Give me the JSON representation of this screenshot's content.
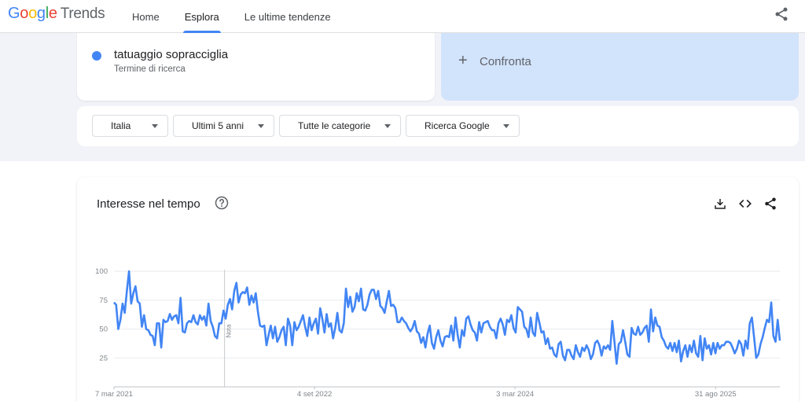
{
  "header": {
    "logo_letters": [
      {
        "ch": "G",
        "color": "#4285f4"
      },
      {
        "ch": "o",
        "color": "#ea4335"
      },
      {
        "ch": "o",
        "color": "#fbbc05"
      },
      {
        "ch": "g",
        "color": "#4285f4"
      },
      {
        "ch": "l",
        "color": "#34a853"
      },
      {
        "ch": "e",
        "color": "#ea4335"
      }
    ],
    "logo_product": "Trends",
    "nav": [
      "Home",
      "Esplora",
      "Le ultime tendenze"
    ],
    "active_nav": "Esplora",
    "share_icon": "share-icon"
  },
  "term": {
    "name": "tatuaggio sopracciglia",
    "subtitle": "Termine di ricerca",
    "color": "#4285f4"
  },
  "compare": {
    "plus": "+",
    "label": "Confronta"
  },
  "filters": [
    "Italia",
    "Ultimi 5 anni",
    "Tutte le categorie",
    "Ricerca Google"
  ],
  "chart_panel": {
    "title": "Interesse nel tempo",
    "help_icon": "help-circle-icon",
    "actions": [
      "download-icon",
      "embed-code-icon",
      "share-icon"
    ]
  },
  "chart_data": {
    "type": "line",
    "title": "Interesse nel tempo",
    "xlabel": "",
    "ylabel": "",
    "yticks": [
      25,
      50,
      75,
      100
    ],
    "ylim": [
      0,
      100
    ],
    "xlim": [
      "2021-03-07",
      "2026-02-22"
    ],
    "xtick_labels": [
      {
        "date": "2021-03-07",
        "label": "7 mar 2021"
      },
      {
        "date": "2022-09-04",
        "label": "4 set 2022"
      },
      {
        "date": "2024-03-03",
        "label": "3 mar 2024"
      },
      {
        "date": "2025-08-31",
        "label": "31 ago 2025"
      }
    ],
    "annotation_date": "2022-01-02",
    "annotation_label": "Nota",
    "grid": true,
    "line_color": "#4285f4",
    "series": [
      {
        "name": "tatuaggio sopracciglia",
        "values": [
          73,
          71,
          50,
          58,
          72,
          64,
          83,
          100,
          72,
          81,
          87,
          74,
          72,
          52,
          62,
          50,
          49,
          45,
          44,
          36,
          55,
          55,
          34,
          58,
          56,
          57,
          63,
          58,
          61,
          62,
          55,
          77,
          48,
          47,
          55,
          57,
          56,
          62,
          56,
          54,
          62,
          58,
          61,
          53,
          72,
          57,
          52,
          44,
          42,
          55,
          55,
          66,
          59,
          71,
          76,
          67,
          83,
          90,
          73,
          80,
          82,
          81,
          86,
          71,
          79,
          73,
          81,
          65,
          53,
          52,
          53,
          36,
          45,
          53,
          42,
          52,
          39,
          43,
          49,
          52,
          36,
          59,
          53,
          36,
          56,
          49,
          52,
          57,
          62,
          52,
          44,
          60,
          49,
          55,
          59,
          46,
          68,
          59,
          47,
          63,
          52,
          55,
          42,
          51,
          64,
          49,
          47,
          55,
          85,
          69,
          78,
          65,
          69,
          81,
          74,
          85,
          67,
          66,
          71,
          80,
          84,
          84,
          76,
          83,
          70,
          68,
          64,
          74,
          83,
          70,
          71,
          68,
          56,
          56,
          60,
          57,
          55,
          51,
          48,
          51,
          57,
          48,
          46,
          38,
          43,
          34,
          46,
          53,
          38,
          33,
          43,
          49,
          40,
          35,
          43,
          44,
          43,
          53,
          40,
          60,
          45,
          34,
          49,
          44,
          59,
          61,
          54,
          49,
          47,
          40,
          56,
          47,
          55,
          56,
          57,
          52,
          49,
          49,
          42,
          55,
          59,
          54,
          45,
          58,
          56,
          62,
          51,
          47,
          69,
          67,
          65,
          52,
          50,
          43,
          60,
          47,
          44,
          64,
          56,
          47,
          48,
          37,
          42,
          33,
          34,
          28,
          26,
          37,
          39,
          27,
          23,
          32,
          32,
          27,
          24,
          36,
          30,
          26,
          34,
          31,
          36,
          32,
          24,
          28,
          38,
          40,
          36,
          27,
          35,
          33,
          36,
          32,
          57,
          39,
          20,
          37,
          39,
          49,
          39,
          28,
          26,
          51,
          46,
          45,
          52,
          45,
          47,
          51,
          53,
          39,
          67,
          48,
          60,
          53,
          52,
          43,
          40,
          35,
          33,
          38,
          31,
          38,
          30,
          40,
          22,
          31,
          36,
          26,
          36,
          30,
          40,
          29,
          26,
          44,
          23,
          42,
          33,
          36,
          28,
          38,
          29,
          38,
          33,
          36,
          36,
          39,
          39,
          38,
          34,
          29,
          33,
          40,
          37,
          27,
          40,
          33,
          55,
          60,
          43,
          25,
          28,
          37,
          43,
          51,
          58,
          56,
          73,
          44,
          39,
          58,
          40
        ]
      }
    ]
  }
}
